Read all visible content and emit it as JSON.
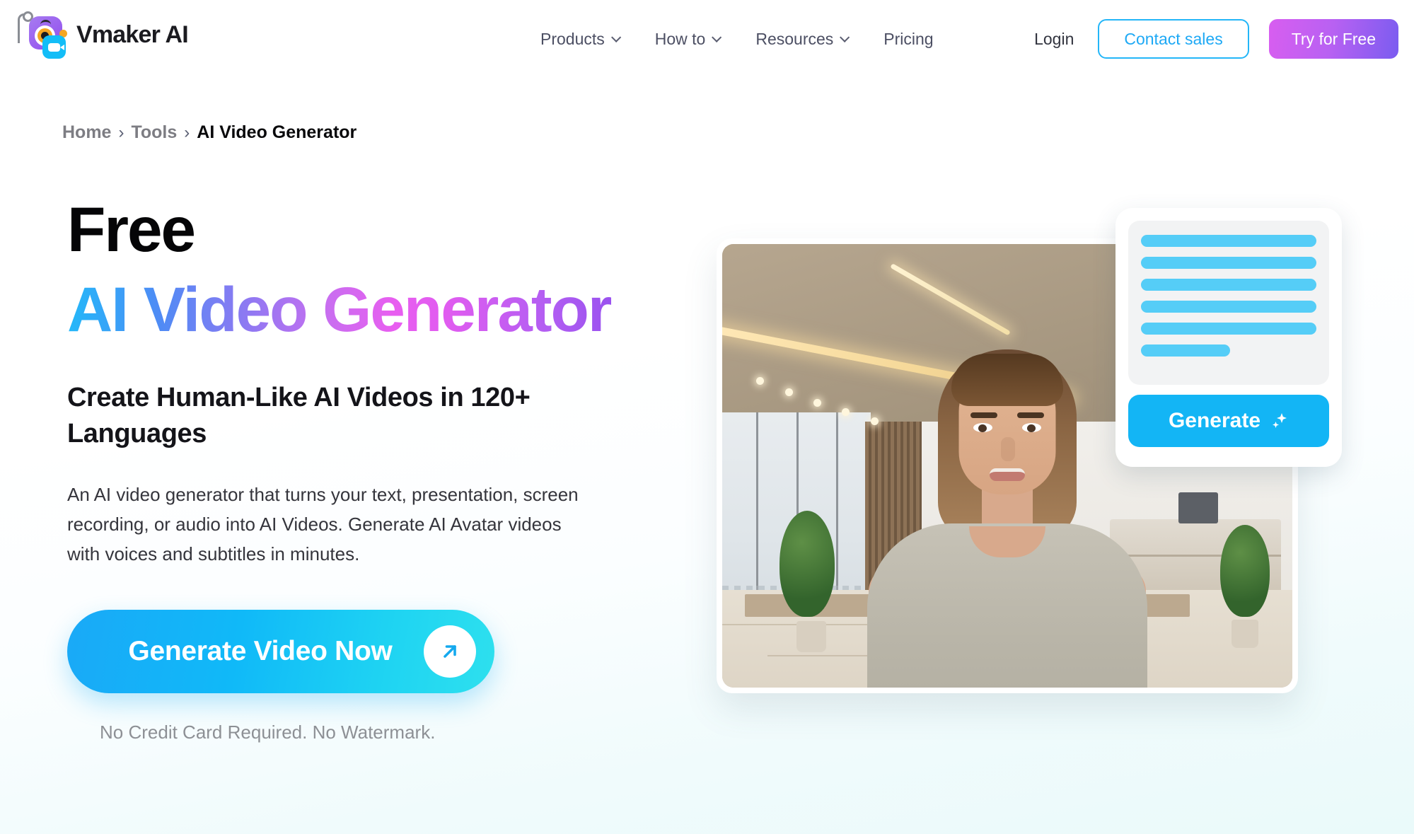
{
  "header": {
    "brand_name": "Vmaker AI",
    "logo_icon": "vmaker-camera-eye-logo",
    "nav": [
      {
        "label": "Products",
        "has_dropdown": true
      },
      {
        "label": "How to",
        "has_dropdown": true
      },
      {
        "label": "Resources",
        "has_dropdown": true
      },
      {
        "label": "Pricing",
        "has_dropdown": false
      }
    ],
    "login_label": "Login",
    "contact_sales_label": "Contact sales",
    "try_free_label": "Try for Free"
  },
  "breadcrumb": {
    "items": [
      "Home",
      "Tools"
    ],
    "current": "AI Video Generator",
    "separator": "›"
  },
  "hero": {
    "title_line1": "Free",
    "title_line2": "AI Video Generator",
    "subhead": "Create Human-Like AI Videos in 120+ Languages",
    "body": "An AI video generator that turns your text, presentation, screen recording, or audio into AI Videos. Generate AI Avatar videos with voices and subtitles in minutes.",
    "cta_label": "Generate Video Now",
    "cta_icon": "arrow-up-right-icon",
    "cta_note": "No Credit Card Required. No Watermark."
  },
  "preview": {
    "video_alt": "AI avatar presenter in modern office",
    "generate_card": {
      "button_label": "Generate",
      "button_icon": "sparkles-icon",
      "text_lines": [
        100,
        100,
        100,
        100,
        100,
        51
      ]
    }
  },
  "colors": {
    "accent_cyan": "#13b5f5",
    "accent_blue": "#1aa9f7",
    "gradient_start": "#23b8f9",
    "gradient_mid": "#e85ef0",
    "gradient_end": "#9a52ef",
    "try_free_start": "#d85ef0",
    "try_free_end": "#7a5cf0",
    "text_dark": "#050507",
    "text_muted": "#8d9095",
    "page_bg": "#ffffff",
    "page_bg_bottom": "#eafafa"
  }
}
